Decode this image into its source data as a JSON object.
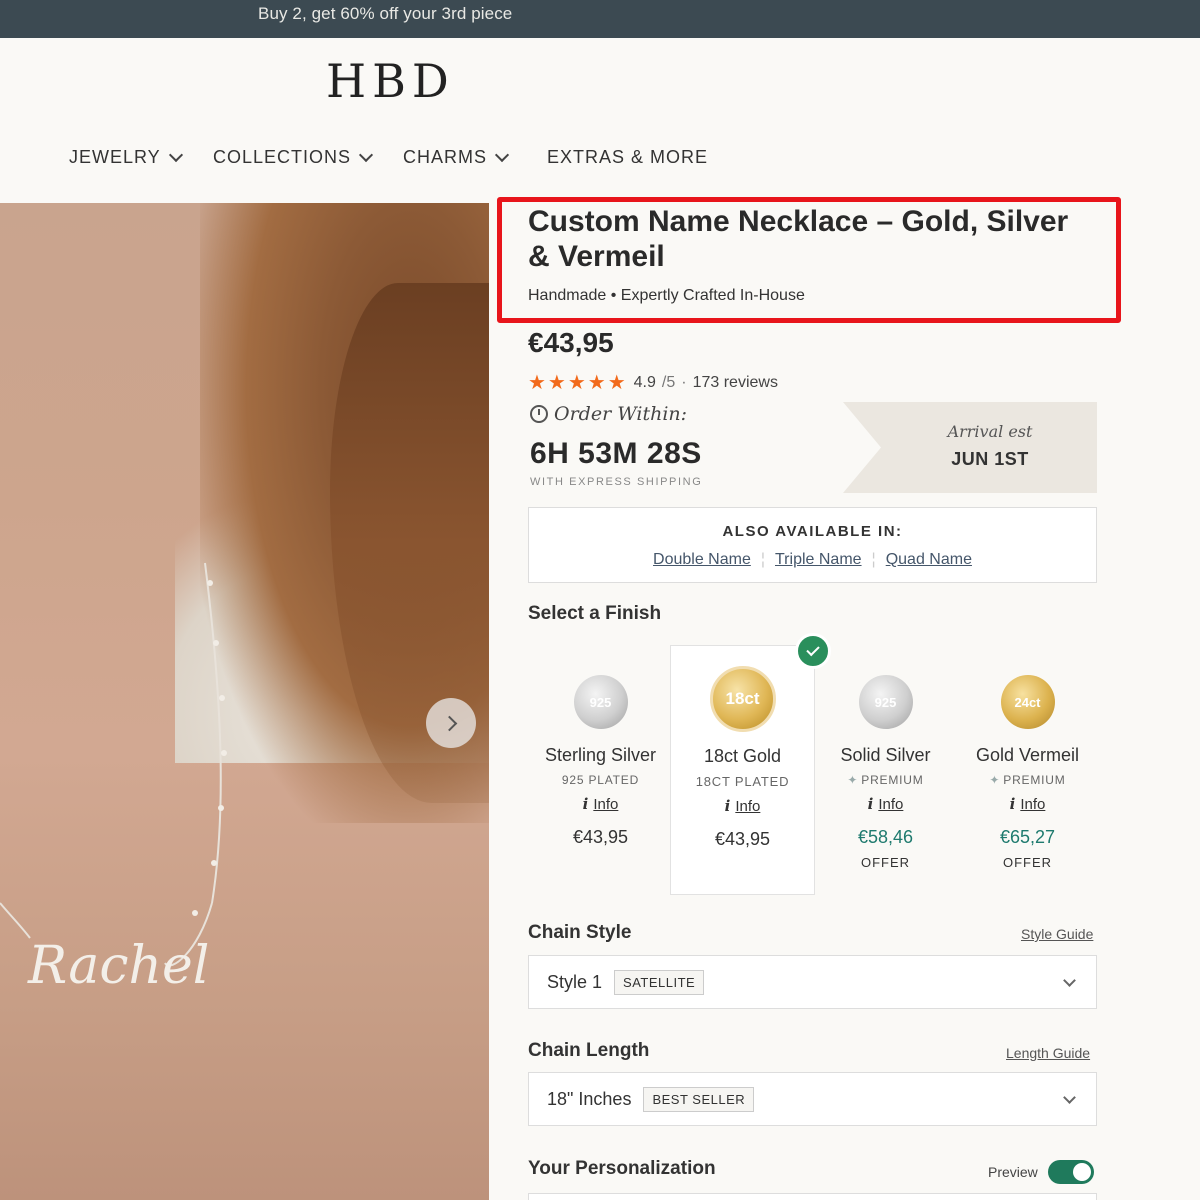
{
  "promo": {
    "text": "Buy 2, get 60% off your 3rd piece"
  },
  "brand": {
    "logo": "HBD"
  },
  "nav": {
    "items": [
      {
        "label": "JEWELRY"
      },
      {
        "label": "COLLECTIONS"
      },
      {
        "label": "CHARMS"
      },
      {
        "label": "EXTRAS & MORE"
      }
    ]
  },
  "product": {
    "title": "Custom Name Necklace – Gold, Silver & Vermeil",
    "subtitle": "Handmade • Expertly Crafted In-House",
    "price": "€43,95",
    "rating": {
      "stars": "★★★★★",
      "score": "4.9",
      "out_of": "/5",
      "dot": "·",
      "reviews": "173 reviews"
    },
    "hero_name_text": "Rachel"
  },
  "shipping": {
    "order_within": "Order Within:",
    "countdown": "6H 53M 28S",
    "express": "WITH EXPRESS SHIPPING",
    "arrival_label": "Arrival est",
    "arrival_date": "JUN 1ST"
  },
  "also_available": {
    "title": "ALSO AVAILABLE IN:",
    "links": [
      "Double Name",
      "Triple Name",
      "Quad Name"
    ]
  },
  "finish": {
    "label": "Select a Finish",
    "options": [
      {
        "badge": "925",
        "name": "Sterling Silver",
        "sub": "925 PLATED",
        "info": "Info",
        "price": "€43,95",
        "offer": ""
      },
      {
        "badge": "18ct",
        "name": "18ct Gold",
        "sub": "18CT PLATED",
        "info": "Info",
        "price": "€43,95",
        "offer": ""
      },
      {
        "badge": "925",
        "name": "Solid Silver",
        "sub": "PREMIUM",
        "info": "Info",
        "price": "€58,46",
        "offer": "OFFER"
      },
      {
        "badge": "24ct",
        "name": "Gold Vermeil",
        "sub": "PREMIUM",
        "info": "Info",
        "price": "€65,27",
        "offer": "OFFER"
      }
    ],
    "selected_index": 1
  },
  "chain_style": {
    "label": "Chain Style",
    "guide": "Style Guide",
    "value": "Style 1",
    "tag": "SATELLITE"
  },
  "chain_length": {
    "label": "Chain Length",
    "guide": "Length Guide",
    "value": "18\" Inches",
    "tag": "BEST SELLER"
  },
  "personalization": {
    "label": "Your Personalization",
    "preview": "Preview",
    "preview_on": true
  },
  "colors": {
    "promo_bg": "#3c4a52",
    "highlight": "#e8151b",
    "star": "#f26a1b",
    "offer": "#1e7a6e",
    "toggle": "#1f7a5c",
    "check": "#2a8f5c"
  }
}
